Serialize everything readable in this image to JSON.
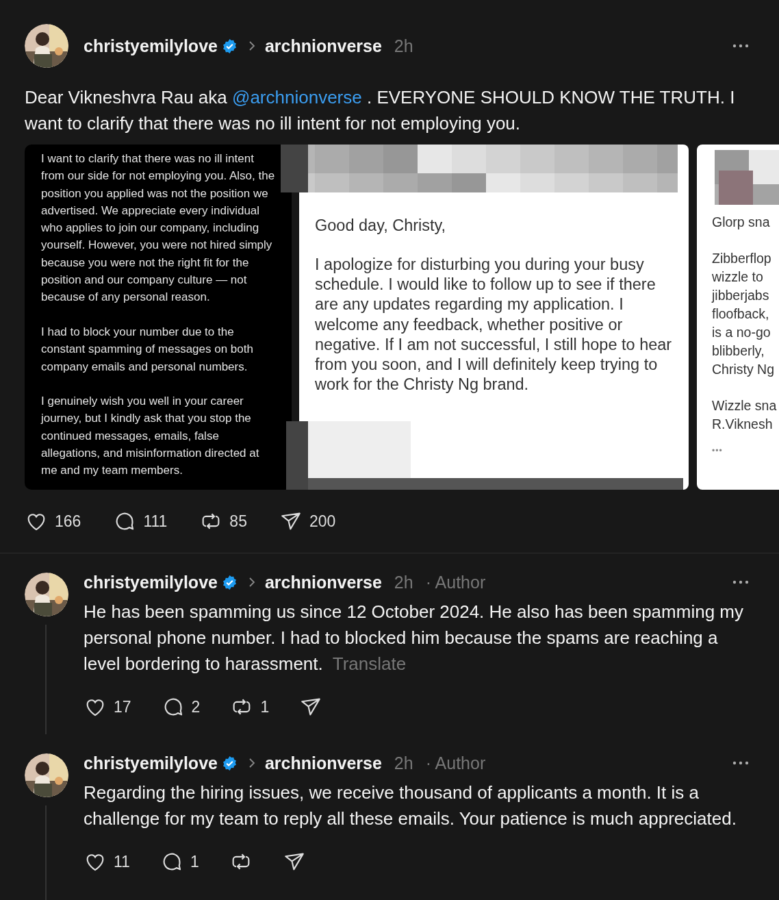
{
  "post": {
    "author": "christyemilylove",
    "verified": true,
    "reply_to": "archnionverse",
    "time": "2h",
    "text": [
      {
        "kind": "plain",
        "text": "Dear Vikneshvra Rau aka "
      },
      {
        "kind": "mention",
        "text": "@archnionverse"
      },
      {
        "kind": "plain",
        "text": " . EVERYONE SHOULD KNOW THE TRUTH. I want to clarify that there was no ill intent for not employing you."
      }
    ],
    "media": [
      {
        "kind": "note",
        "paragraphs": [
          "I want to clarify that there was no ill intent from our side for not employing you. Also, the position you applied was not the position we advertised. We appreciate every individual who applies to join our company, including yourself. However, you were not hired simply because you were not the right fit for the position and our company culture — not because of any personal reason.",
          "I had to block your number due to the constant spamming of messages on both company emails and personal numbers.",
          "I genuinely wish you well in your career journey, but I kindly ask that you stop the continued messages, emails, false allegations, and misinformation directed at me and my team members."
        ]
      },
      {
        "kind": "email",
        "greeting": "Good day, Christy,",
        "body": "I apologize for disturbing you during your busy schedule. I would like to follow up to see if there are any updates regarding my application. I welcome any feedback, whether positive or negative. If I am not successful, I still hope to hear from you soon, and I will definitely keep trying to work for the Christy Ng brand."
      },
      {
        "kind": "cropped",
        "blocks": [
          [
            "Glorp sna"
          ],
          [
            "Zibberflop",
            "wizzle to",
            "jibberjabs",
            "floofback,",
            "is a no-go",
            "blibberly,",
            "Christy Ng"
          ],
          [
            "Wizzle sna",
            "R.Viknesh"
          ]
        ],
        "more": "•••"
      }
    ],
    "stats": {
      "likes": "166",
      "comments": "111",
      "reposts": "85",
      "shares": "200"
    }
  },
  "replies": [
    {
      "author": "christyemilylove",
      "verified": true,
      "reply_to": "archnionverse",
      "time": "2h",
      "tag": "· Author",
      "text": "He has been spamming us since 12 October 2024. He also has been spamming my personal phone number. I had to blocked him because the spams are reaching a level bordering to harassment.",
      "translate": "Translate",
      "stats": {
        "likes": "17",
        "comments": "2",
        "reposts": "1"
      }
    },
    {
      "author": "christyemilylove",
      "verified": true,
      "reply_to": "archnionverse",
      "time": "2h",
      "tag": "· Author",
      "text": "Regarding the hiring issues, we receive thousand of applicants a month. It is a challenge for my team to reply all these emails. Your patience is much appreciated.",
      "stats": {
        "likes": "11",
        "comments": "1"
      }
    }
  ]
}
